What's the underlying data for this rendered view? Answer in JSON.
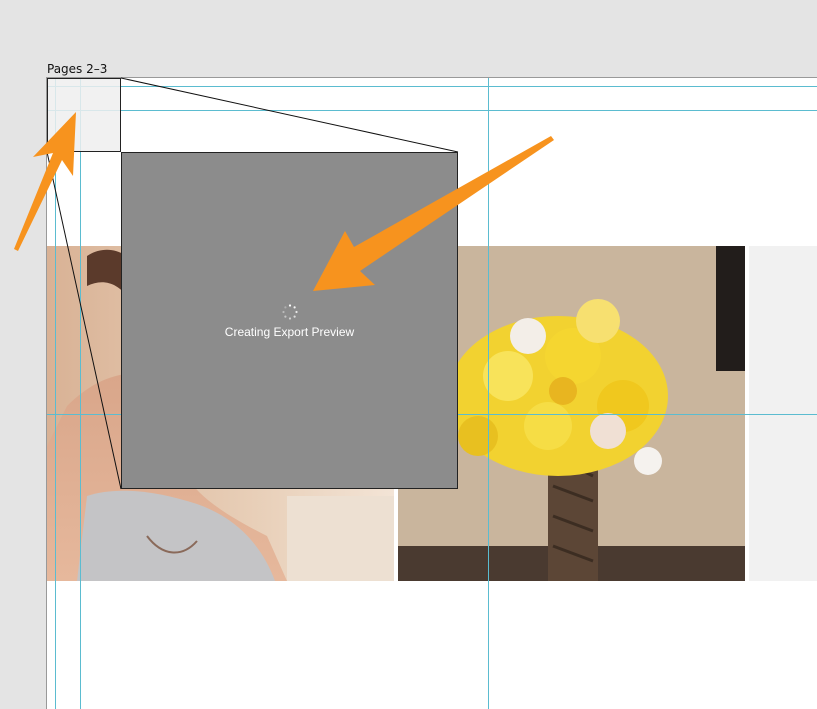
{
  "spread": {
    "label": "Pages 2–3"
  },
  "export_preview": {
    "status_text": "Creating Export Preview"
  },
  "annotations": {
    "arrow_color": "#f7931e"
  },
  "colors": {
    "guide": "#5bbcd0",
    "preview_background": "#8c8c8c",
    "canvas": "#e4e4e4"
  }
}
